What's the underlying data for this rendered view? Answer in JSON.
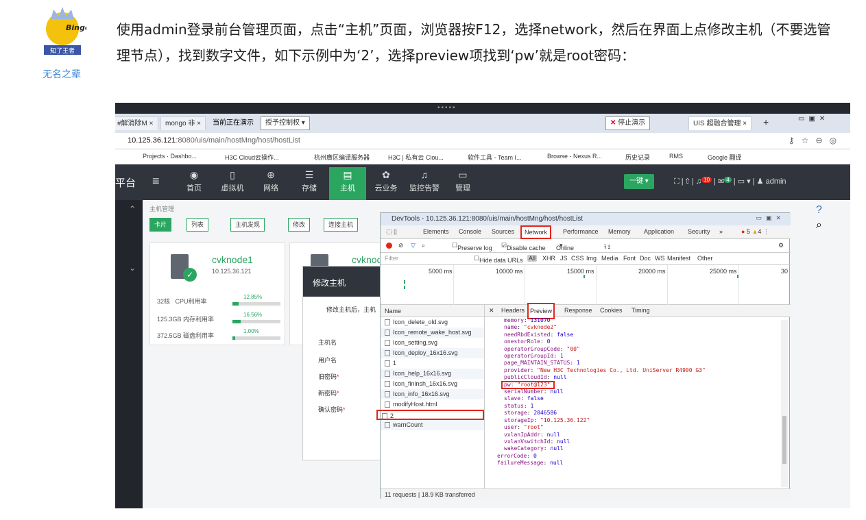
{
  "author": {
    "avatar_text": "Bingo",
    "badge": "知了王者",
    "name": "无名之辈"
  },
  "paragraph": "使用admin登录前台管理页面，点击“主机”页面，浏览器按F12，选择network，然后在界面上点修改主机（不要选管理节点），找到数字文件，如下示例中为‘2’，选择preview项找到‘pw’就是root密码：",
  "screenshot": {
    "browser": {
      "tabs": [
        "#解消除M ×",
        "mongo 非 ×",
        "UIS 超融合管理 ×"
      ],
      "presenting_label": "当前正在演示",
      "give_control": "授予控制权 ▾",
      "stop_present": "停止演示",
      "url_host": "10.125.36.121",
      "url_path": ":8080/uis/main/hostMng/host/hostList",
      "bookmarks": [
        "Projects · Dashbo...",
        "H3C Cloud云操作...",
        "杭州廣区编译服务器",
        "H3C | 私有云 Clou...",
        "软件工具 - Team I...",
        "Browse - Nexus R...",
        "历史记录",
        "RMS",
        "Google 翻译"
      ]
    },
    "app": {
      "brand": "平台",
      "nav": [
        "首页",
        "虚拟机",
        "网络",
        "存储",
        "主机",
        "云业务",
        "监控告警",
        "管理"
      ],
      "active_nav": "主机",
      "one_key": "一键 ▾",
      "badge_bell": "10",
      "badge_mail": "4",
      "user": "admin",
      "breadcrumb": "主机管理",
      "toolbar": [
        "卡片",
        "列表",
        "主机发现",
        "修改",
        "连接主机"
      ],
      "card": {
        "title": "cvknode1",
        "ip": "10.125.36.121",
        "stats": [
          {
            "label": "32核",
            "metric": "CPU利用率",
            "pct": "12.85%",
            "value": 12.85
          },
          {
            "label": "125.3GB",
            "metric": "内存利用率",
            "pct": "16.56%",
            "value": 16.56
          },
          {
            "label": "372.5GB",
            "metric": "磁盘利用率",
            "pct": "1.00%",
            "value": 1.0
          }
        ]
      },
      "card2_title": "cvknode",
      "dialog": {
        "title": "修改主机",
        "note": "修改主机后，主机",
        "fields": [
          "主机名",
          "用户名",
          "旧密码",
          "新密码",
          "确认密码"
        ]
      }
    },
    "devtools": {
      "title": "DevTools - 10.125.36.121:8080/uis/main/hostMng/host/hostList",
      "tabs": [
        "Elements",
        "Console",
        "Sources",
        "Network",
        "Performance",
        "Memory",
        "Application",
        "Security",
        "»"
      ],
      "errors": "5",
      "warnings": "4",
      "controls": [
        "Preserve log",
        "Disable cache",
        "Online"
      ],
      "filter_placeholder": "Filter",
      "filter_types": [
        "Hide data URLs",
        "All",
        "XHR",
        "JS",
        "CSS",
        "Img",
        "Media",
        "Font",
        "Doc",
        "WS",
        "Manifest",
        "Other"
      ],
      "timeline": [
        "5000 ms",
        "10000 ms",
        "15000 ms",
        "20000 ms",
        "25000 ms",
        "30"
      ],
      "list_header": "Name",
      "requests": [
        "Icon_delete_old.svg",
        "Icon_remote_wake_host.svg",
        "Icon_setting.svg",
        "Icon_deploy_16x16.svg",
        "1",
        "Icon_help_16x16.svg",
        "Icon_fininsh_16x16.svg",
        "Icon_info_16x16.svg",
        "modifyHost.html",
        "2",
        "warnCount"
      ],
      "detail_tabs": [
        "Headers",
        "Preview",
        "Response",
        "Cookies",
        "Timing"
      ],
      "preview": [
        {
          "k": "memory",
          "v": "131070",
          "t": "n"
        },
        {
          "k": "name",
          "v": "\"cvknode2\"",
          "t": "s"
        },
        {
          "k": "needRbdExisted",
          "v": "false",
          "t": "n"
        },
        {
          "k": "onestorRole",
          "v": "0",
          "t": "n"
        },
        {
          "k": "operatorGroupCode",
          "v": "\"00\"",
          "t": "s"
        },
        {
          "k": "operatorGroupId",
          "v": "1",
          "t": "n"
        },
        {
          "k": "page_MAINTAIN_STATUS",
          "v": "1",
          "t": "n"
        },
        {
          "k": "provider",
          "v": "\"New H3C Technologies Co., Ltd. UniServer R4900 G3\"",
          "t": "s"
        },
        {
          "k": "publicCloudId",
          "v": "null",
          "t": "n"
        },
        {
          "k": "pw",
          "v": "\"root@123\"",
          "t": "s"
        },
        {
          "k": "serialNumber",
          "v": "null",
          "t": "n"
        },
        {
          "k": "slave",
          "v": "false",
          "t": "n"
        },
        {
          "k": "status",
          "v": "1",
          "t": "n"
        },
        {
          "k": "storage",
          "v": "2046586",
          "t": "n"
        },
        {
          "k": "storageIp",
          "v": "\"10.125.36.122\"",
          "t": "s"
        },
        {
          "k": "user",
          "v": "\"root\"",
          "t": "s"
        },
        {
          "k": "vxlanIpAddr",
          "v": "null",
          "t": "n"
        },
        {
          "k": "vxlanVswitchId",
          "v": "null",
          "t": "n"
        },
        {
          "k": "wakeCategory",
          "v": "null",
          "t": "n"
        },
        {
          "k": "errorCode",
          "v": "0",
          "t": "n"
        },
        {
          "k": "failureMessage",
          "v": "null",
          "t": "n"
        }
      ],
      "status": "11 requests | 18.9 KB transferred"
    }
  }
}
